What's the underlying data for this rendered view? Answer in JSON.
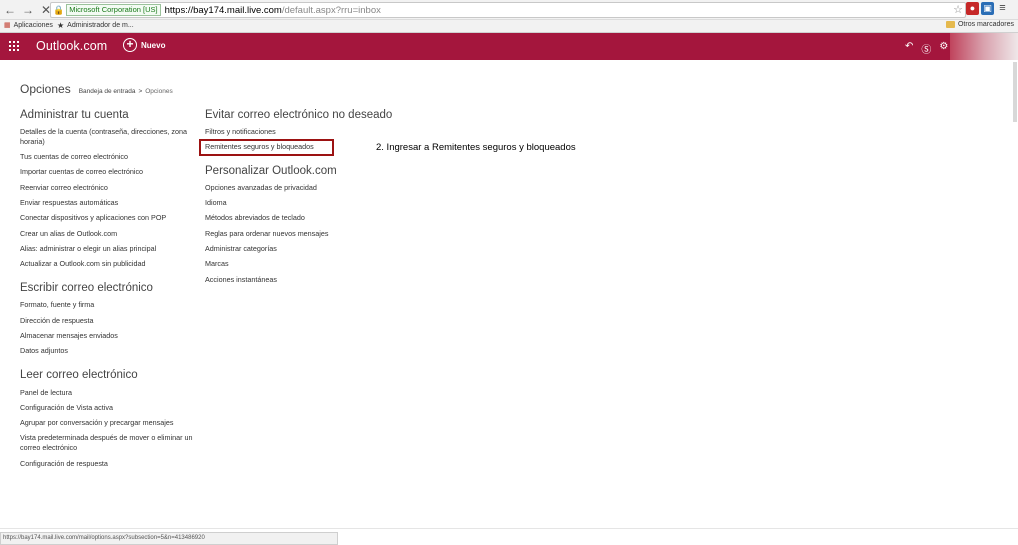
{
  "browser": {
    "back_glyph": "←",
    "forward_glyph": "→",
    "stop_glyph": "✕",
    "ev_label": "Microsoft Corporation [US]",
    "url_host": "https://bay174.mail.live.com",
    "url_path": "/default.aspx?rru=inbox",
    "menu_glyph": "≡"
  },
  "bookmarks": {
    "apps": "Aplicaciones",
    "admin": "Administrador de m...",
    "other": "Otros marcadores"
  },
  "header": {
    "brand": "Outlook.com",
    "new_label": "Nuevo",
    "color": "#a4163d"
  },
  "breadcrumb": {
    "title": "Opciones",
    "path_inbox": "Bandeja de entrada",
    "separator": ">",
    "path_current": "Opciones"
  },
  "sections": {
    "account": {
      "title": "Administrar tu cuenta",
      "items": [
        "Detalles de la cuenta (contraseña, direcciones, zona horaria)",
        "Tus cuentas de correo electrónico",
        "Importar cuentas de correo electrónico",
        "Reenviar correo electrónico",
        "Enviar respuestas automáticas",
        "Conectar dispositivos y aplicaciones con POP",
        "Crear un alias de Outlook.com",
        "Alias: administrar o elegir un alias principal",
        "Actualizar a Outlook.com sin publicidad"
      ]
    },
    "write": {
      "title": "Escribir correo electrónico",
      "items": [
        "Formato, fuente y firma",
        "Dirección de respuesta",
        "Almacenar mensajes enviados",
        "Datos adjuntos"
      ]
    },
    "read": {
      "title": "Leer correo electrónico",
      "items": [
        "Panel de lectura",
        "Configuración de Vista activa",
        "Agrupar por conversación y precargar mensajes",
        "Vista predeterminada después de mover o eliminar un correo electrónico",
        "Configuración de respuesta"
      ]
    },
    "junk": {
      "title": "Evitar correo electrónico no deseado",
      "items": [
        "Filtros y notificaciones",
        "Remitentes seguros y bloqueados"
      ]
    },
    "personalize": {
      "title": "Personalizar Outlook.com",
      "items": [
        "Opciones avanzadas de privacidad",
        "Idioma",
        "Métodos abreviados de teclado",
        "Reglas para ordenar nuevos mensajes",
        "Administrar categorías",
        "Marcas",
        "Acciones instantáneas"
      ]
    }
  },
  "annotation": "2. Ingresar a Remitentes seguros y bloqueados",
  "status_bar": "https://bay174.mail.live.com/mail/options.aspx?subsection=5&n=413486920"
}
